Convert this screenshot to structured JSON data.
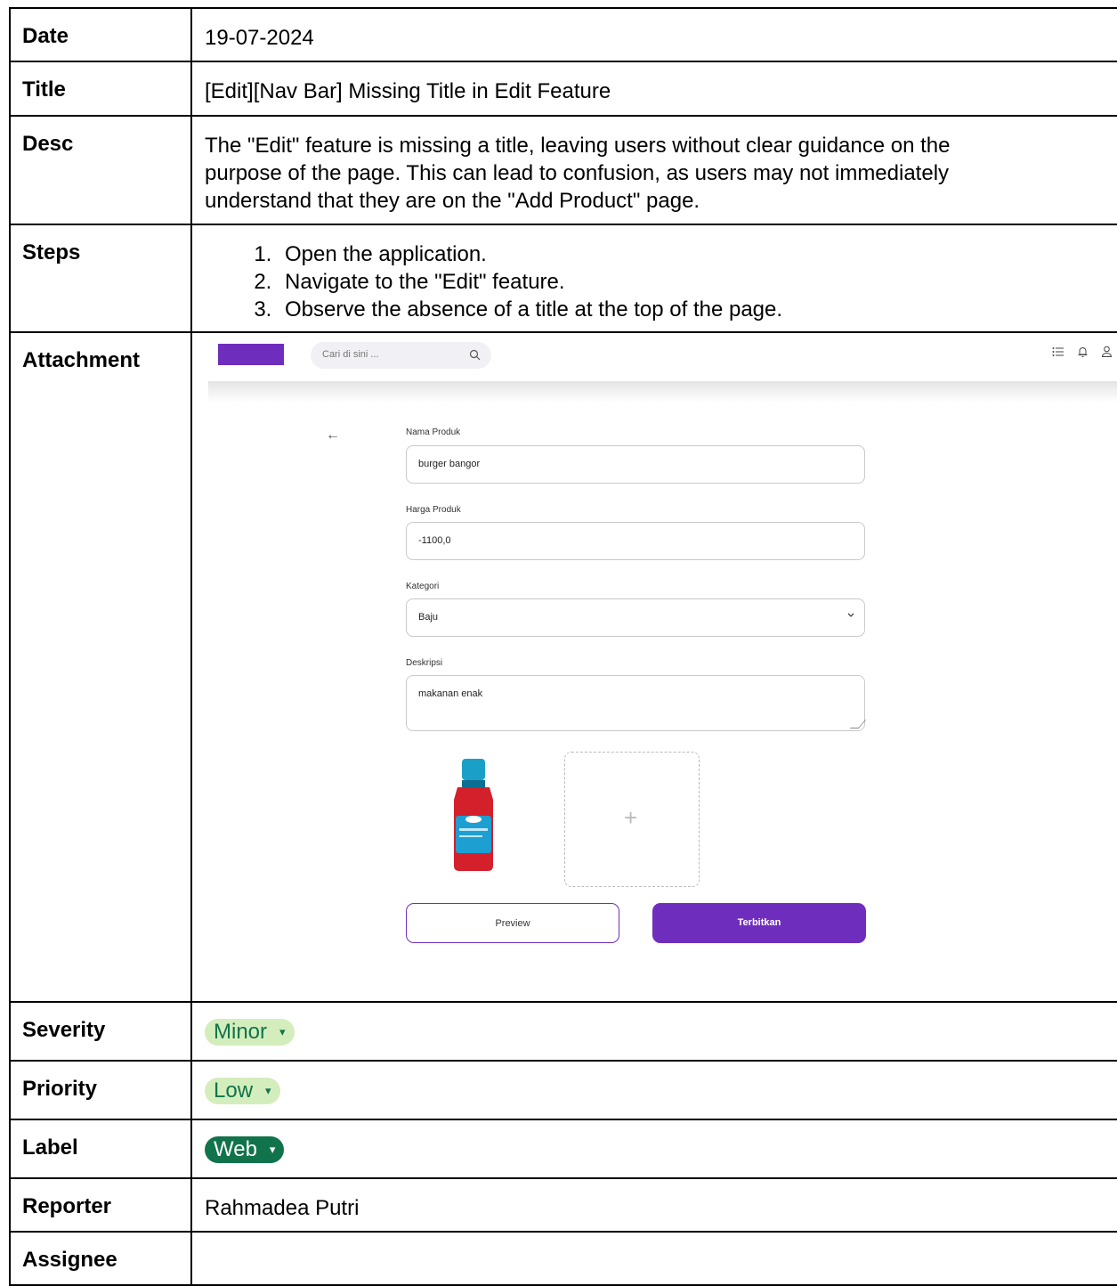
{
  "rows": {
    "date": {
      "label": "Date",
      "value": "19-07-2024"
    },
    "title": {
      "label": "Title",
      "value": "[Edit][Nav Bar] Missing Title in Edit Feature"
    },
    "desc": {
      "label": "Desc",
      "line1": "The \"Edit\" feature is missing a title, leaving users without clear guidance on the",
      "line2": "purpose of the page. This can lead to confusion, as users may not immediately",
      "line3": "understand that they are on the \"Add Product\" page."
    },
    "steps": {
      "label": "Steps",
      "items": [
        "Open the application.",
        "Navigate to the \"Edit\" feature.",
        "Observe the absence of a title at the top of the page."
      ]
    },
    "attachment": {
      "label": "Attachment"
    },
    "severity": {
      "label": "Severity",
      "value": "Minor"
    },
    "priority": {
      "label": "Priority",
      "value": "Low"
    },
    "tag": {
      "label": "Label",
      "value": "Web"
    },
    "reporter": {
      "label": "Reporter",
      "value": "Rahmadea Putri"
    },
    "assignee": {
      "label": "Assignee",
      "value": ""
    }
  },
  "chip_colors": {
    "light_bg": "#d4edbc",
    "light_text": "#11734b",
    "dark_bg": "#11734b",
    "dark_text": "#ffffff"
  },
  "attachment_screen": {
    "brand_color": "#6f2dbd",
    "search_placeholder": "Cari di sini ...",
    "icons": [
      "search-icon",
      "list-icon",
      "bell-icon",
      "user-icon",
      "back-arrow-icon",
      "chevron-down-icon",
      "plus-icon"
    ],
    "fields": {
      "name_label": "Nama Produk",
      "name_value": "burger bangor",
      "price_label": "Harga Produk",
      "price_value": "-1100,0",
      "category_label": "Kategori",
      "category_value": "Baju",
      "desc_label": "Deskripsi",
      "desc_value": "makanan enak"
    },
    "preview_label": "Preview",
    "publish_label": "Terbitkan"
  }
}
